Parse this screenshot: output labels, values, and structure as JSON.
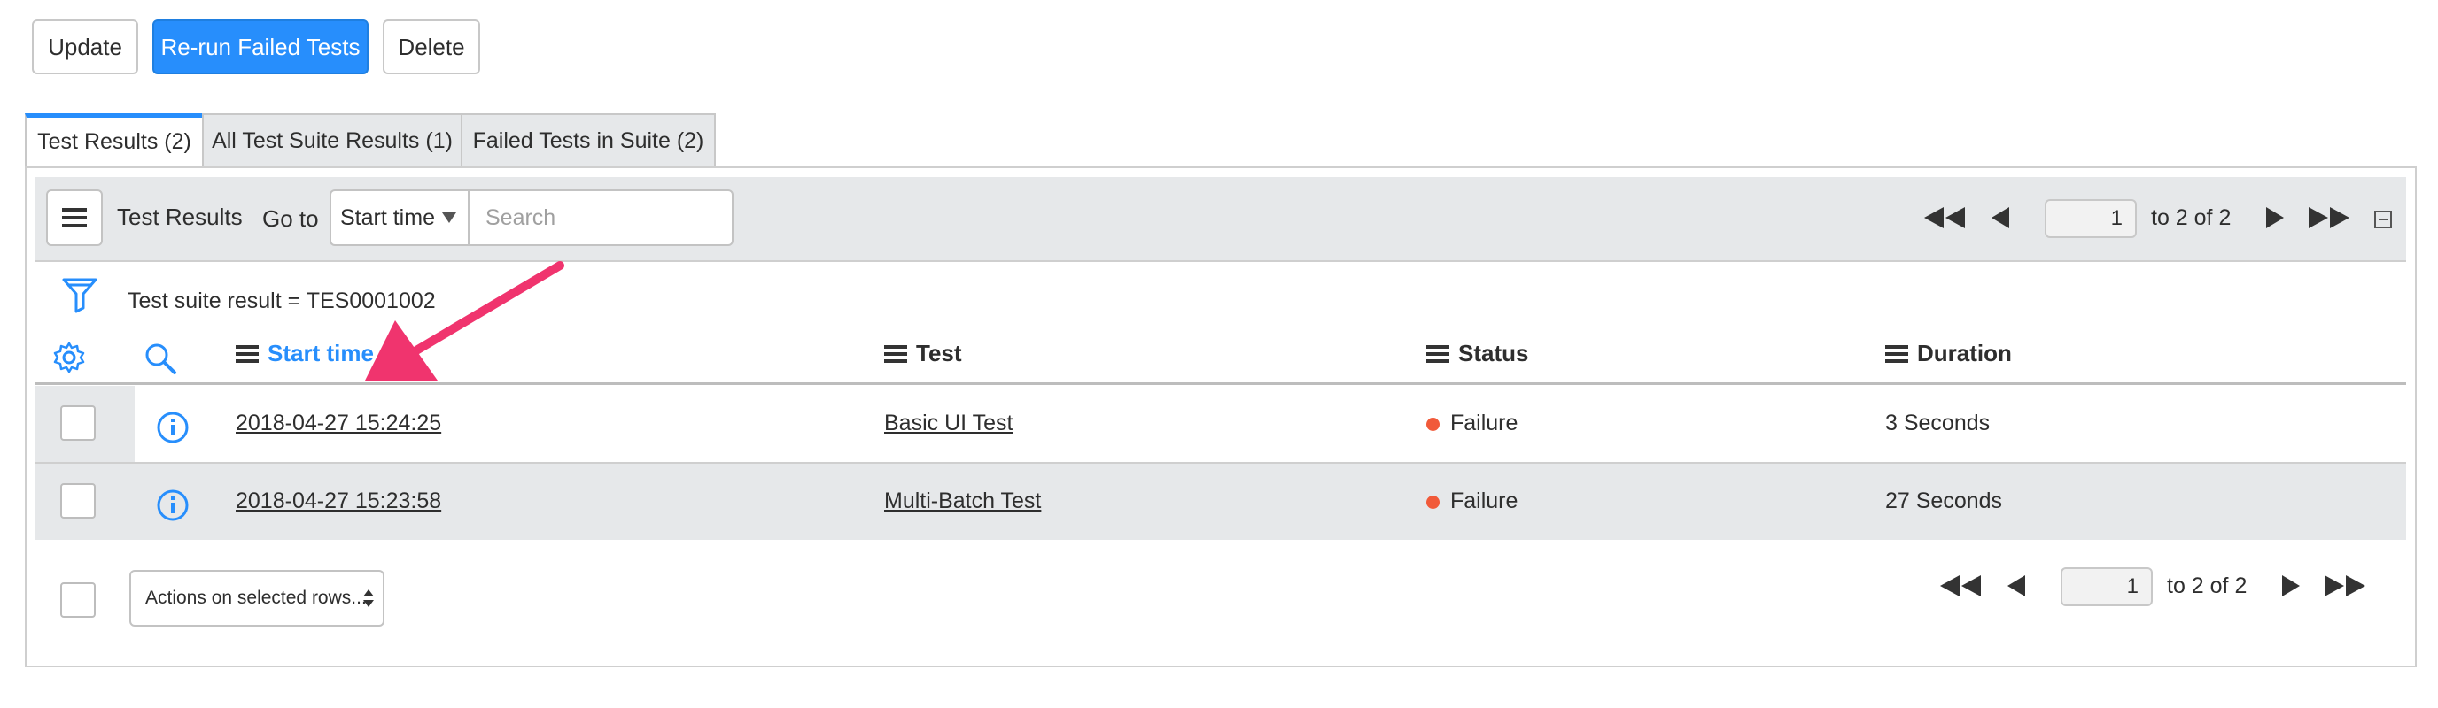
{
  "buttons": {
    "update": "Update",
    "rerun": "Re-run Failed Tests",
    "delete": "Delete"
  },
  "tabs": [
    {
      "label": "Test Results (2)",
      "active": true
    },
    {
      "label": "All Test Suite Results (1)",
      "active": false
    },
    {
      "label": "Failed Tests in Suite (2)",
      "active": false
    }
  ],
  "list": {
    "title": "Test Results",
    "goto_label": "Go to",
    "goto_field": "Start time",
    "search_placeholder": "Search",
    "page_value": "1",
    "page_range": "to 2 of 2",
    "filter": "Test suite result = TES0001002"
  },
  "columns": {
    "start_time": "Start time",
    "test": "Test",
    "status": "Status",
    "duration": "Duration"
  },
  "rows": [
    {
      "start_time": "2018-04-27 15:24:25",
      "test": "Basic UI Test",
      "status": "Failure",
      "duration": "3 Seconds"
    },
    {
      "start_time": "2018-04-27 15:23:58",
      "test": "Multi-Batch Test",
      "status": "Failure",
      "duration": "27 Seconds"
    }
  ],
  "footer": {
    "actions_label": "Actions on selected rows...",
    "page_value": "1",
    "page_range": "to 2 of 2"
  },
  "colors": {
    "accent": "#278efc",
    "failure": "#f15a3a",
    "annotation_arrow": "#f0346e"
  },
  "icons": {
    "hamburger": "list-menu-icon",
    "filter": "funnel-icon",
    "settings": "gear-icon",
    "search": "search-icon",
    "info": "info-icon",
    "first": "first-page-icon",
    "prev": "prev-page-icon",
    "next": "next-page-icon",
    "last": "last-page-icon",
    "collapse": "collapse-icon"
  }
}
